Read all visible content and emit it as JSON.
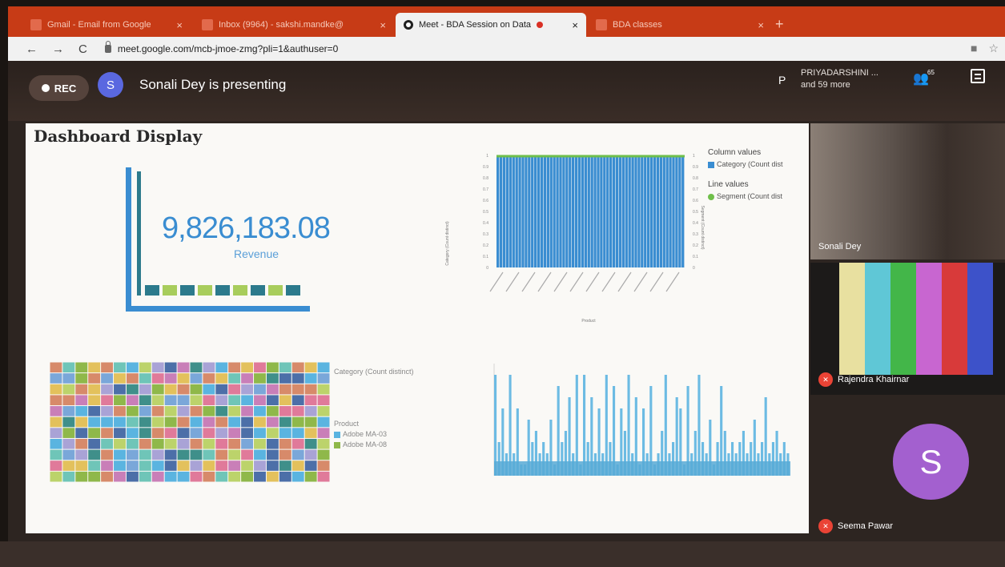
{
  "tabs": [
    {
      "title": "Gmail - Email from Google",
      "close": "×"
    },
    {
      "title": "Inbox (9964) - sakshi.mandke@",
      "close": "×"
    },
    {
      "title": "Meet - BDA Session on Data",
      "close": "×"
    },
    {
      "title": "BDA classes",
      "close": "×"
    }
  ],
  "toolbar": {
    "back": "←",
    "forward": "→",
    "reload": "C",
    "url": "meet.google.com/mcb-jmoe-zmg?pli=1&authuser=0",
    "star": "☆"
  },
  "meet": {
    "rec_label": "REC",
    "presenter_initial": "S",
    "presenting_text": "Sonali Dey is presenting",
    "participant_initial": "P",
    "participant_name": "PRIYADARSHINI ...",
    "participant_more": "and 59 more",
    "people_count": "65"
  },
  "slide": {
    "title": "Dashboard Display",
    "kpi_value": "9,826,183.08",
    "kpi_label": "Revenue",
    "legend_top": {
      "column_heading": "Column values",
      "column_item": "Category (Count dist",
      "line_heading": "Line values",
      "line_item": "Segment (Count dist"
    },
    "legend_tree": {
      "category_heading": "Category (Count distinct)",
      "product_heading": "Product",
      "items": [
        "Adobe MA-03",
        "Adobe MA-08"
      ]
    },
    "colors": {
      "primary_blue": "#3a8dd1",
      "green": "#6fbf4a",
      "teal": "#2c7a8c"
    }
  },
  "participants": [
    {
      "name": "Sonali Dey"
    },
    {
      "name": "Rajendra Khairnar"
    },
    {
      "name": "Seema Pawar",
      "initial": "S"
    }
  ],
  "chart_data": [
    {
      "type": "bar",
      "title": "",
      "xlabel": "Product",
      "ylabel": "Category (Count distinct)",
      "y2label": "Segment (Count distinct)",
      "ylim": [
        0,
        1
      ],
      "y_ticks": [
        0,
        0.1,
        0.2,
        0.3,
        0.4,
        0.5,
        0.6,
        0.7,
        0.8,
        0.9,
        1
      ],
      "categories_count": 60,
      "series": [
        {
          "name": "Category (Count dist",
          "kind": "column",
          "value": 1
        },
        {
          "name": "Segment (Count dist",
          "kind": "line",
          "value": 1
        }
      ]
    },
    {
      "type": "bar",
      "title": "",
      "values": [
        0.9,
        0.3,
        0.6,
        0.2,
        0.9,
        0.2,
        0.6,
        0.1,
        0.1,
        0.5,
        0.3,
        0.4,
        0.2,
        0.3,
        0.2,
        0.5,
        0.1,
        0.8,
        0.3,
        0.4,
        0.7,
        0.2,
        0.9,
        0.1,
        0.9,
        0.3,
        0.7,
        0.2,
        0.6,
        0.2,
        0.9,
        0.3,
        0.8,
        0.1,
        0.6,
        0.4,
        0.9,
        0.2,
        0.7,
        0.1,
        0.6,
        0.2,
        0.8,
        0.1,
        0.2,
        0.4,
        0.9,
        0.2,
        0.3,
        0.7,
        0.6,
        0.1,
        0.8,
        0.2,
        0.4,
        0.9,
        0.3,
        0.2,
        0.5,
        0.1,
        0.3,
        0.8,
        0.4,
        0.2,
        0.3,
        0.2,
        0.3,
        0.4,
        0.2,
        0.3,
        0.5,
        0.2,
        0.3,
        0.7,
        0.2,
        0.3,
        0.4,
        0.2,
        0.3,
        0.2
      ]
    }
  ]
}
